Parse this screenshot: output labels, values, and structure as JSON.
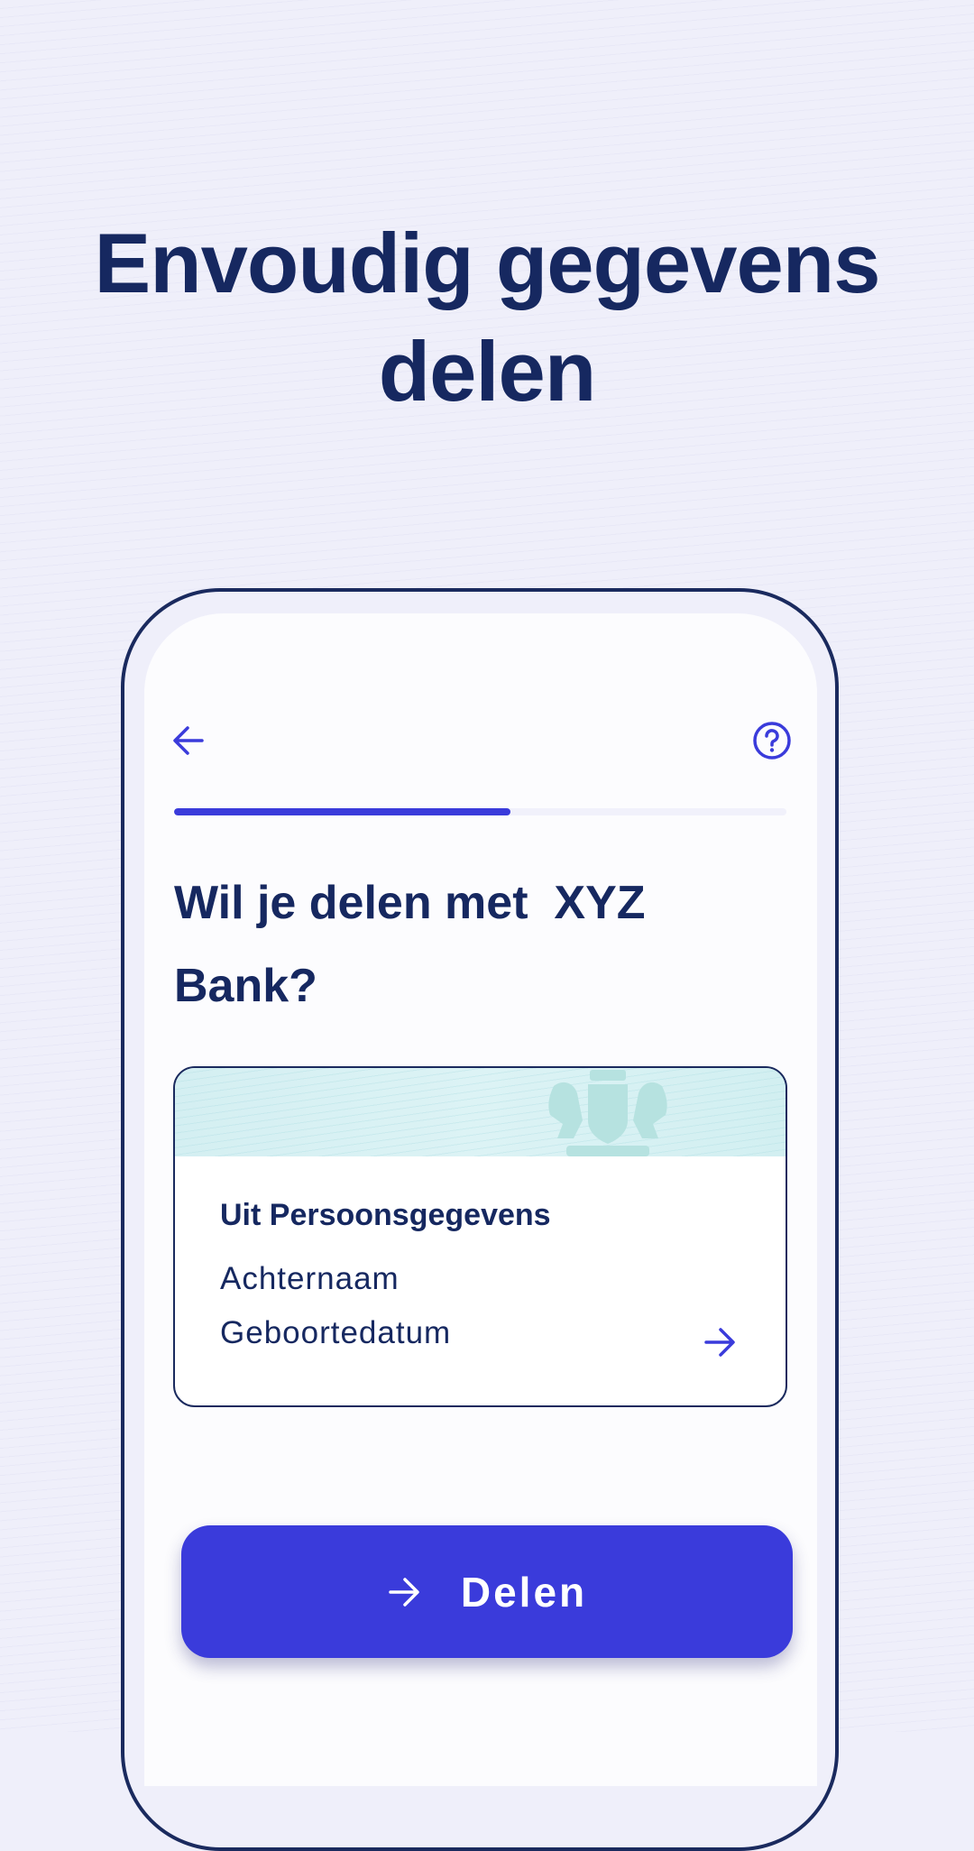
{
  "hero": {
    "line1": "Envoudig gegevens",
    "line2": "delen"
  },
  "screen": {
    "back_icon": "arrow-left-icon",
    "help_icon": "question-circle-icon",
    "progress_percent": 55,
    "heading": "Wil je delen met  XYZ Bank?",
    "card": {
      "title": "Uit Persoonsgegevens",
      "items": [
        "Achternaam",
        "Geboortedatum"
      ],
      "chevron_icon": "arrow-right-icon"
    },
    "share_button": {
      "label": "Delen",
      "icon": "arrow-right-icon"
    }
  },
  "colors": {
    "accent": "#3a3bdb",
    "text": "#162860",
    "background": "#efeffa"
  }
}
